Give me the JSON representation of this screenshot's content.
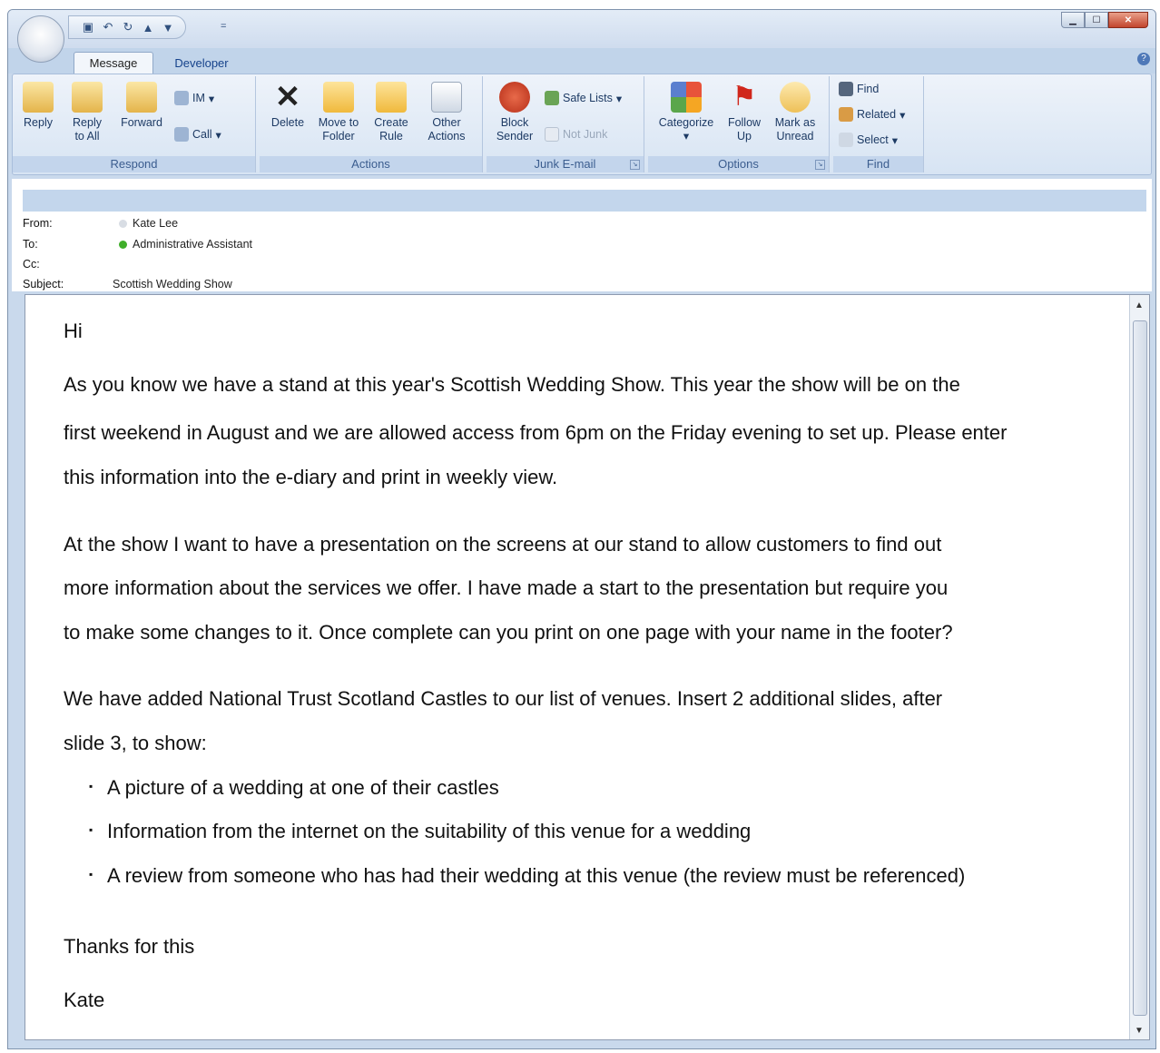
{
  "qat": {
    "more": "="
  },
  "tabs": [
    {
      "label": "Message"
    },
    {
      "label": "Developer"
    }
  ],
  "ribbon": {
    "respond": {
      "label": "Respond",
      "reply": "Reply",
      "reply_all_1": "Reply",
      "reply_all_2": "to All",
      "forward": "Forward",
      "im": "IM",
      "call": "Call"
    },
    "actions": {
      "label": "Actions",
      "delete": "Delete",
      "move_1": "Move to",
      "move_2": "Folder",
      "create_1": "Create",
      "create_2": "Rule",
      "other_1": "Other",
      "other_2": "Actions"
    },
    "junk": {
      "label": "Junk E-mail",
      "block_1": "Block",
      "block_2": "Sender",
      "safe_lists": "Safe Lists",
      "not_junk": "Not Junk"
    },
    "options": {
      "label": "Options",
      "categorize": "Categorize",
      "follow_1": "Follow",
      "follow_2": "Up",
      "mark_1": "Mark as",
      "mark_2": "Unread"
    },
    "find": {
      "label": "Find",
      "find": "Find",
      "related": "Related",
      "select": "Select"
    }
  },
  "header": {
    "from_label": "From:",
    "from": "Kate Lee",
    "to_label": "To:",
    "to": "Administrative Assistant",
    "cc_label": "Cc:",
    "subject_label": "Subject:",
    "subject": "Scottish Wedding Show"
  },
  "colors": {
    "presence_online": "#3fae2a",
    "presence_unknown": "#d8dde4"
  },
  "body": {
    "greeting": "Hi",
    "p1_l1": "As you know we have a stand at this year's Scottish Wedding Show. This year the show will be on the",
    "p1_l2": "first weekend in August and we are allowed access from 6pm on the Friday evening to set up. Please enter",
    "p1_l3": "this information into the e-diary and print in weekly view.",
    "p2_l1": "At the show I want to have a presentation on the screens at our stand to allow customers to find out",
    "p2_l2": "more information about the services we offer. I have made a start to the presentation but require you",
    "p2_l3": "to make some changes to it. Once complete can you print on one page with your name in the footer?",
    "p3_l1": "We have added National Trust Scotland Castles to our list of venues. Insert 2 additional slides, after",
    "p3_l2": "slide 3, to show:",
    "bullets": [
      "A picture of a wedding at one of their castles",
      "Information from the internet on the suitability of this venue for a wedding",
      "A review from someone who has had their wedding at this venue (the review must be referenced)"
    ],
    "thanks": "Thanks for this",
    "signoff": "Kate"
  }
}
